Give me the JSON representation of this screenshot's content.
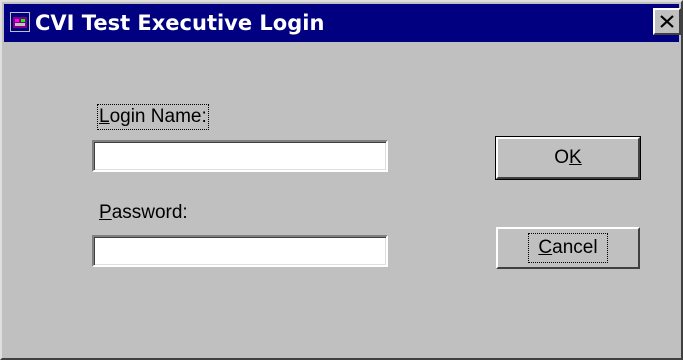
{
  "window": {
    "title": "CVI Test Executive Login"
  },
  "form": {
    "login_name": {
      "label_mnemonic": "L",
      "label_rest": "ogin Name:",
      "value": ""
    },
    "password": {
      "label_mnemonic": "P",
      "label_rest": "assword:",
      "value": ""
    }
  },
  "buttons": {
    "ok": {
      "label_main": "O",
      "label_mnemonic": "K"
    },
    "cancel": {
      "label_mnemonic": "C",
      "label_rest": "ancel"
    }
  },
  "icons": {
    "app": "app-window-icon",
    "close": "close-x-icon"
  },
  "colors": {
    "titlebar": "#000080",
    "face": "#c0c0c0"
  }
}
